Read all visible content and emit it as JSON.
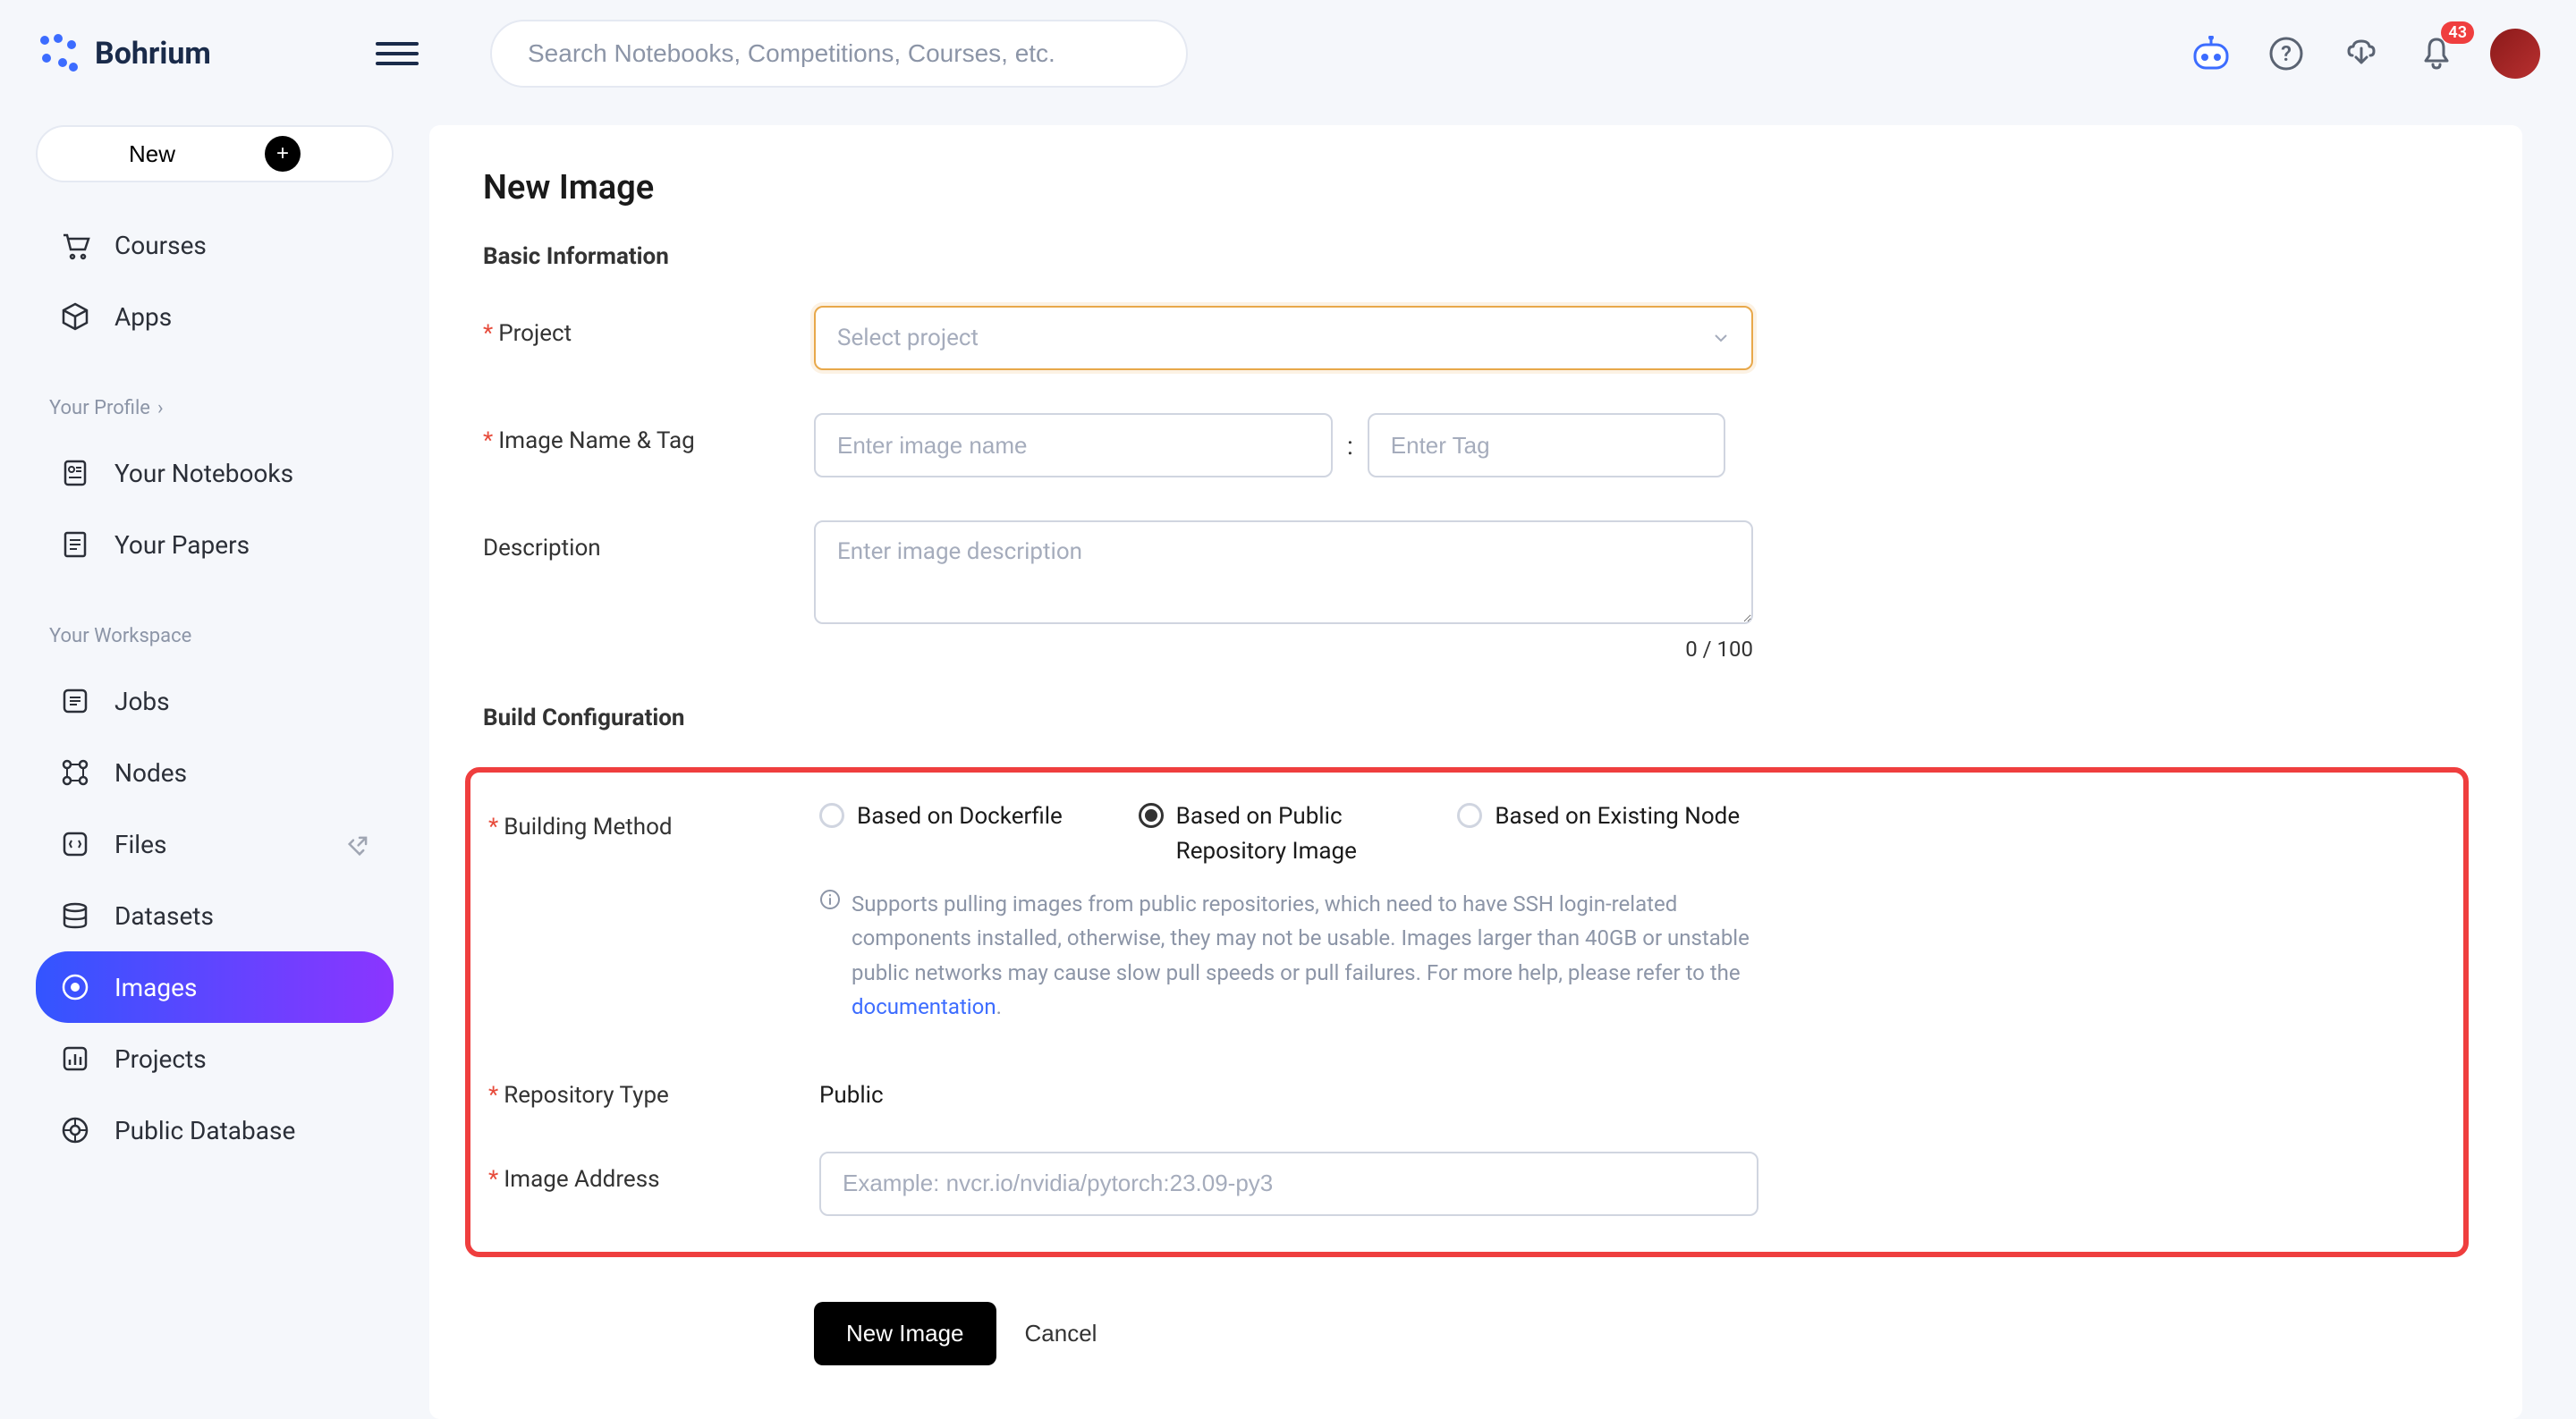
{
  "brand": "Bohrium",
  "search": {
    "placeholder": "Search Notebooks, Competitions, Courses, etc."
  },
  "notifications": {
    "count": "43"
  },
  "sidebar": {
    "new_button": "New",
    "top_items": [
      {
        "label": "Courses",
        "icon": "cart"
      },
      {
        "label": "Apps",
        "icon": "cube"
      }
    ],
    "profile_label": "Your Profile",
    "profile_items": [
      {
        "label": "Your Notebooks",
        "icon": "notebook"
      },
      {
        "label": "Your Papers",
        "icon": "paper"
      }
    ],
    "workspace_label": "Your Workspace",
    "workspace_items": [
      {
        "label": "Jobs",
        "icon": "list"
      },
      {
        "label": "Nodes",
        "icon": "nodes"
      },
      {
        "label": "Files",
        "icon": "files",
        "has_share": true
      },
      {
        "label": "Datasets",
        "icon": "datasets"
      },
      {
        "label": "Images",
        "icon": "images",
        "active": true
      },
      {
        "label": "Projects",
        "icon": "projects"
      },
      {
        "label": "Public Database",
        "icon": "db"
      }
    ]
  },
  "page": {
    "title": "New Image",
    "basic_section": "Basic Information",
    "build_section": "Build Configuration",
    "labels": {
      "project": "Project",
      "name_tag": "Image Name & Tag",
      "description": "Description",
      "building_method": "Building Method",
      "repo_type": "Repository Type",
      "image_address": "Image Address"
    },
    "placeholders": {
      "project": "Select project",
      "image_name": "Enter image name",
      "tag": "Enter Tag",
      "description": "Enter image description",
      "image_address": "Example: nvcr.io/nvidia/pytorch:23.09-py3"
    },
    "char_count": "0 / 100",
    "radio_options": [
      "Based on Dockerfile",
      "Based on Public Repository Image",
      "Based on Existing Node"
    ],
    "radio_selected": 1,
    "info_text": "Supports pulling images from public repositories, which need to have SSH login-related components installed, otherwise, they may not be usable. Images larger than 40GB or unstable public networks may cause slow pull speeds or pull failures. For more help, please refer to the ",
    "info_link": "documentation",
    "repo_type_value": "Public",
    "submit_button": "New Image",
    "cancel_button": "Cancel"
  }
}
